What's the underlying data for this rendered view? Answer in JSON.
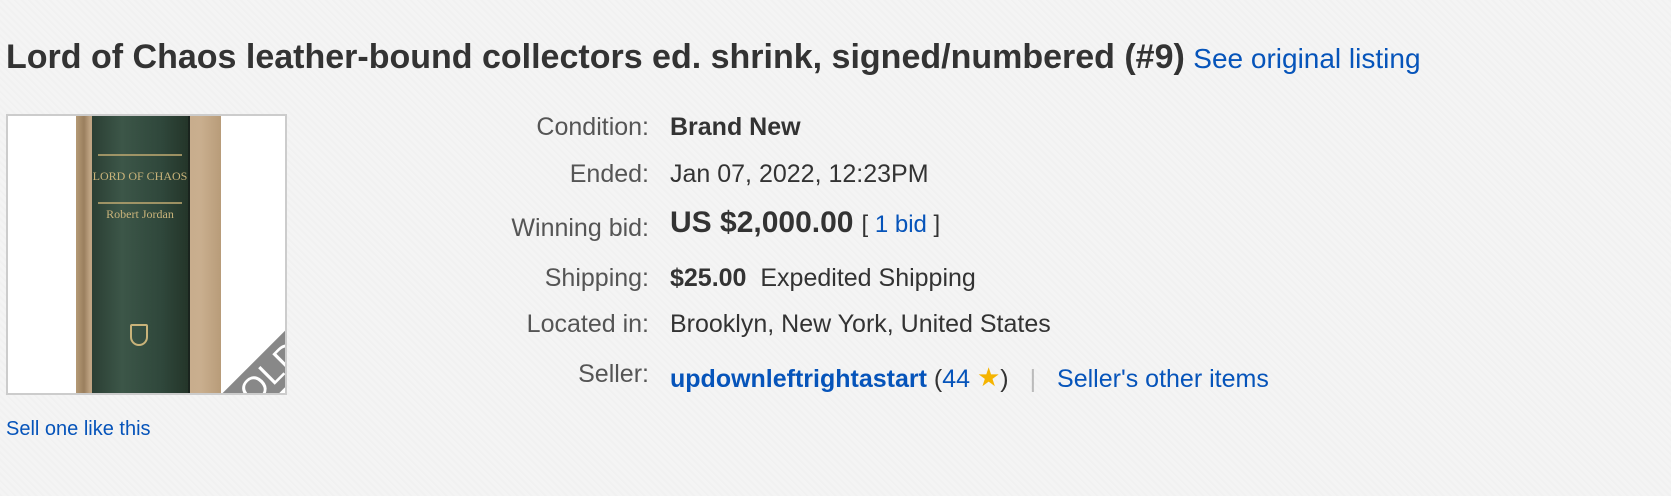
{
  "listing": {
    "title": "Lord of Chaos leather-bound collectors ed. shrink, signed/numbered (#9)",
    "see_original_label": "See original listing",
    "sell_one_label": "Sell one like this"
  },
  "thumbnail": {
    "sold_label": "SOLD",
    "spine_title": "LORD OF CHAOS",
    "spine_author": "Robert Jordan"
  },
  "details": {
    "condition_label": "Condition:",
    "condition_value": "Brand New",
    "ended_label": "Ended:",
    "ended_date": "Jan 07, 2022",
    "ended_time": ", 12:23PM",
    "winning_bid_label": "Winning bid:",
    "winning_bid_value": "US $2,000.00",
    "bid_open": "[",
    "bid_count": "1 bid",
    "bid_close": "]",
    "shipping_label": "Shipping:",
    "shipping_cost": "$25.00",
    "shipping_method": "Expedited Shipping",
    "located_label": "Located in:",
    "located_value": "Brooklyn, New York, United States",
    "seller_label": "Seller:",
    "seller_name": "updownleftrightastart",
    "feedback_open": "(",
    "feedback_score": "44",
    "feedback_close": ")",
    "separator": "|",
    "seller_other_items": "Seller's other items"
  },
  "colors": {
    "link": "#0654ba",
    "text": "#333333",
    "label": "#555555",
    "sold_ribbon": "#888888",
    "star": "#f5b400"
  },
  "icons": {
    "feedback_star": "star-icon"
  }
}
